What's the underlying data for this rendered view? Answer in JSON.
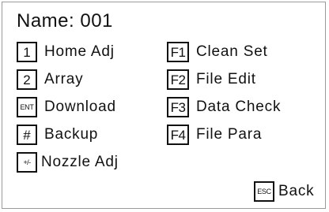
{
  "title": "Name: 001",
  "left_menu": [
    {
      "key": "1",
      "label": "Home Adj"
    },
    {
      "key": "2",
      "label": "Array"
    },
    {
      "key": "ENT",
      "label": "Download"
    },
    {
      "key": "#",
      "label": "Backup"
    },
    {
      "key": "+/-",
      "label": "Nozzle Adj"
    }
  ],
  "right_menu": [
    {
      "key": "F1",
      "label": "Clean Set"
    },
    {
      "key": "F2",
      "label": "File Edit"
    },
    {
      "key": "F3",
      "label": "Data Check"
    },
    {
      "key": "F4",
      "label": "File Para"
    }
  ],
  "back": {
    "key": "ESC",
    "label": "Back"
  }
}
